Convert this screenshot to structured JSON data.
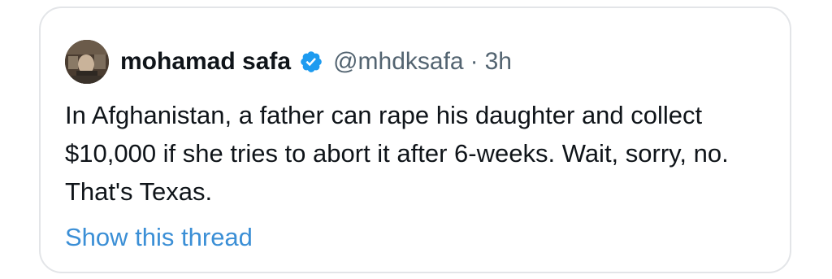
{
  "tweet": {
    "display_name": "mohamad safa",
    "verified": true,
    "handle": "@mhdksafa",
    "separator": "·",
    "time": "3h",
    "text": "In Afghanistan, a father can rape his daughter and collect $10,000 if she tries to abort it after 6-weeks. Wait, sorry, no. That's Texas.",
    "show_thread_label": "Show this thread"
  },
  "colors": {
    "verified_badge": "#1d9bf0",
    "link": "#3b8fd6",
    "secondary_text": "#536471",
    "primary_text": "#0f1419"
  },
  "icons": {
    "verified": "verified-badge-icon"
  }
}
